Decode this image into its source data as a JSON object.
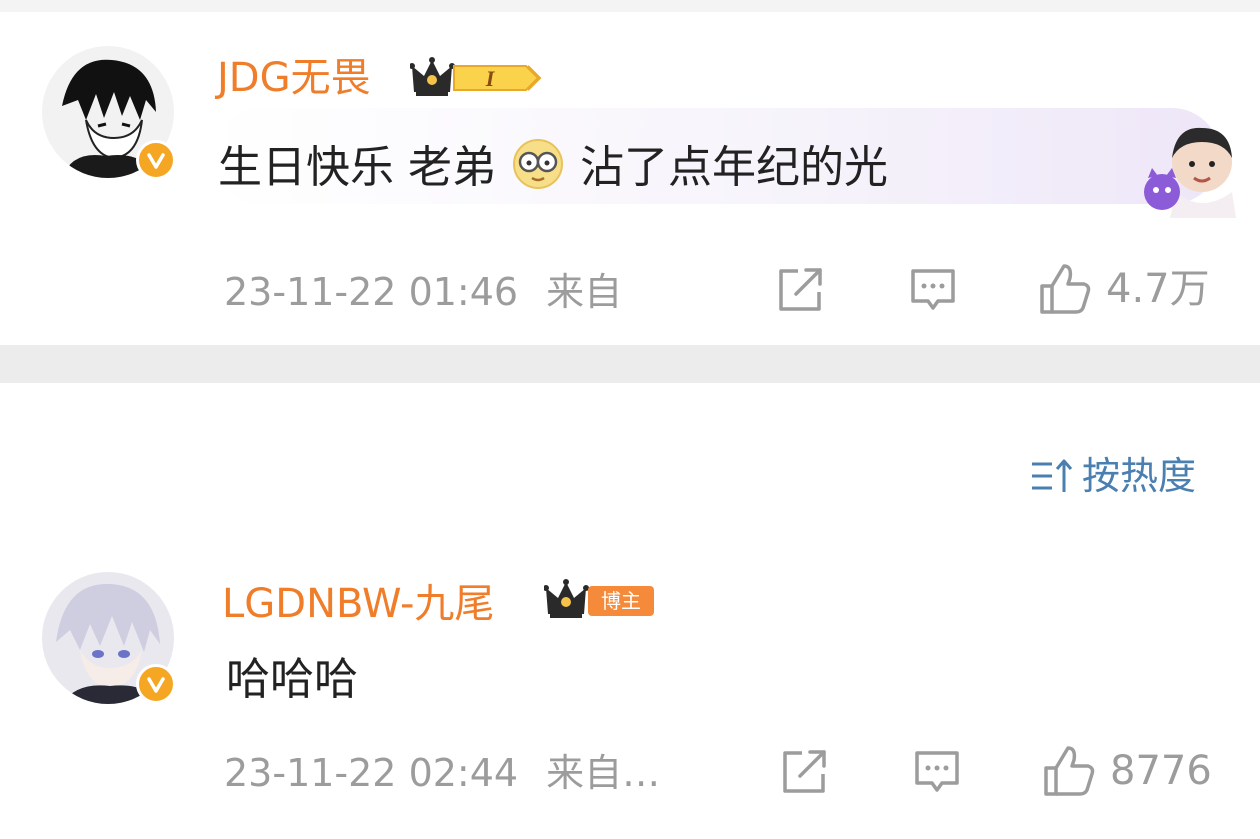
{
  "comments": [
    {
      "username": "JDG无畏",
      "badge_label": "I",
      "text_before": "生日快乐 老弟",
      "text_after": "沾了点年纪的光",
      "emoji_icon": "glasses-face-emoji",
      "timestamp": "23-11-22 01:46",
      "source": "来自",
      "like_count": "4.7万"
    },
    {
      "username": "LGDNBW-九尾",
      "badge_label": "博主",
      "text": "哈哈哈",
      "timestamp": "23-11-22 02:44",
      "source": "来自…",
      "like_count": "8776"
    }
  ],
  "sort": {
    "label": "按热度",
    "icon": "sort-icon"
  },
  "colors": {
    "username": "#f07d2a",
    "meta": "#9c9c9c",
    "accent_blue": "#4a7fb0",
    "verified": "#f5a623",
    "divider": "#ececec"
  }
}
